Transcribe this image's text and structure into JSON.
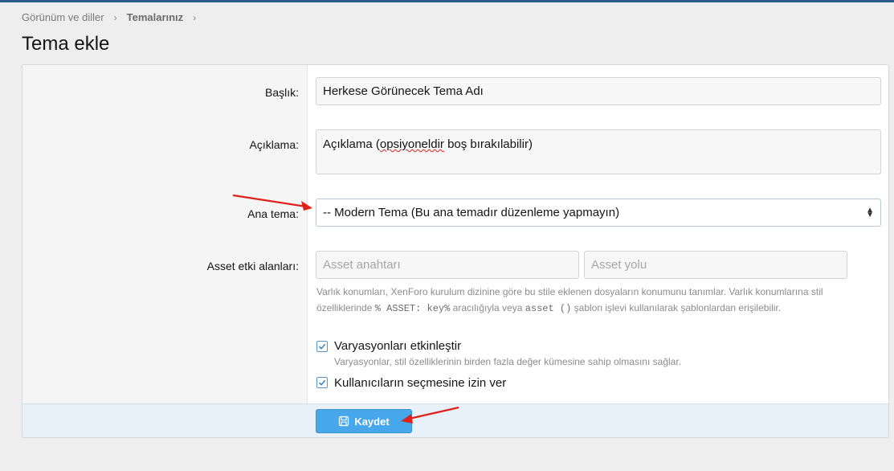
{
  "breadcrumb": {
    "item1": "Görünüm ve diller",
    "item2": "Temalarınız",
    "separator": "›"
  },
  "page_title": "Tema ekle",
  "form": {
    "title_label": "Başlık:",
    "title_value": "Herkese Görünecek Tema Adı",
    "description_label": "Açıklama:",
    "description_value_pre": "Açıklama (",
    "description_value_mid": "opsiyoneldir",
    "description_value_post": " boş bırakılabilir)",
    "parent_label": "Ana tema:",
    "parent_value": "-- Modern Tema (Bu ana temadır düzenleme yapmayın)",
    "asset_label": "Asset etki alanları:",
    "asset_key_placeholder": "Asset anahtarı",
    "asset_path_placeholder": "Asset yolu",
    "asset_hint_1": "Varlık konumları, XenForo kurulum dizinine göre bu stile eklenen dosyaların konumunu tanımlar. Varlık konumlarına stil özelliklerinde ",
    "asset_hint_code1": "% ASSET: key%",
    "asset_hint_2": " aracılığıyla veya ",
    "asset_hint_code2": "asset ()",
    "asset_hint_3": " şablon işlevi kullanılarak şablonlardan erişilebilir.",
    "variations_label": "Varyasyonları etkinleştir",
    "variations_hint": "Varyasyonlar, stil özelliklerinin birden fazla değer kümesine sahip olmasını sağlar.",
    "variations_checked": true,
    "user_select_label": "Kullanıcıların seçmesine izin ver",
    "user_select_checked": true
  },
  "save_button": {
    "label": "Kaydet",
    "icon": "save-icon"
  },
  "colors": {
    "accent": "#47a7eb",
    "arrow": "#e0201b",
    "footer_bg": "#e8f1fa"
  }
}
